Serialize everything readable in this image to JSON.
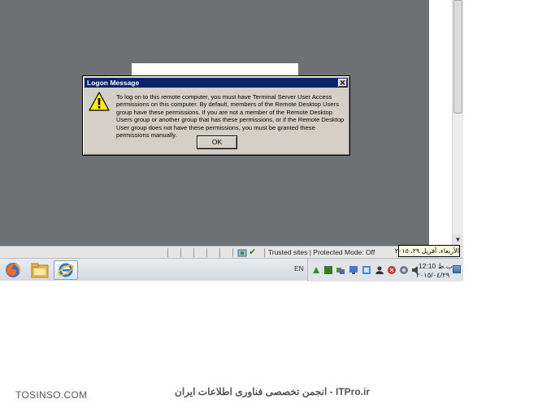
{
  "dialog": {
    "title": "Logon Message",
    "close_glyph": "✕",
    "message": "To log on to this remote computer, you must have Terminal Server User Access permissions on this computer.  By default, members of the Remote Desktop Users group have these permissions.  If you are not a member of the Remote Desktop Users group or another group that has these permissions, or if the Remote Desktop User group does not have these permissions, you must be granted these permissions manually.",
    "ok_label": "OK"
  },
  "status_bar": {
    "zone_text": "Trusted sites | Protected Mode: Off"
  },
  "tooltip": {
    "date_text": "الأربعاء، أفريل ٢٩، ٢٠١٥"
  },
  "taskbar": {
    "language": "EN",
    "clock_time": "12:10 ب.ظ",
    "clock_date": "٢٠١٥/٠٤/٢٩"
  },
  "icons": {
    "warning": "warning-icon",
    "firefox": "firefox-icon",
    "explorer": "folder-icon",
    "ie": "internet-explorer-icon",
    "check": "check-icon"
  },
  "watermarks": {
    "left": "TOSINSO.COM",
    "right": "ITPro.ir - انجمن تخصصی فناوری اطلاعات ایران"
  },
  "colors": {
    "titlebar": "#0a246a",
    "dialog_bg": "#d4d0c8",
    "remote_bg": "#6d7173",
    "tooltip_bg": "#ffffe1"
  }
}
